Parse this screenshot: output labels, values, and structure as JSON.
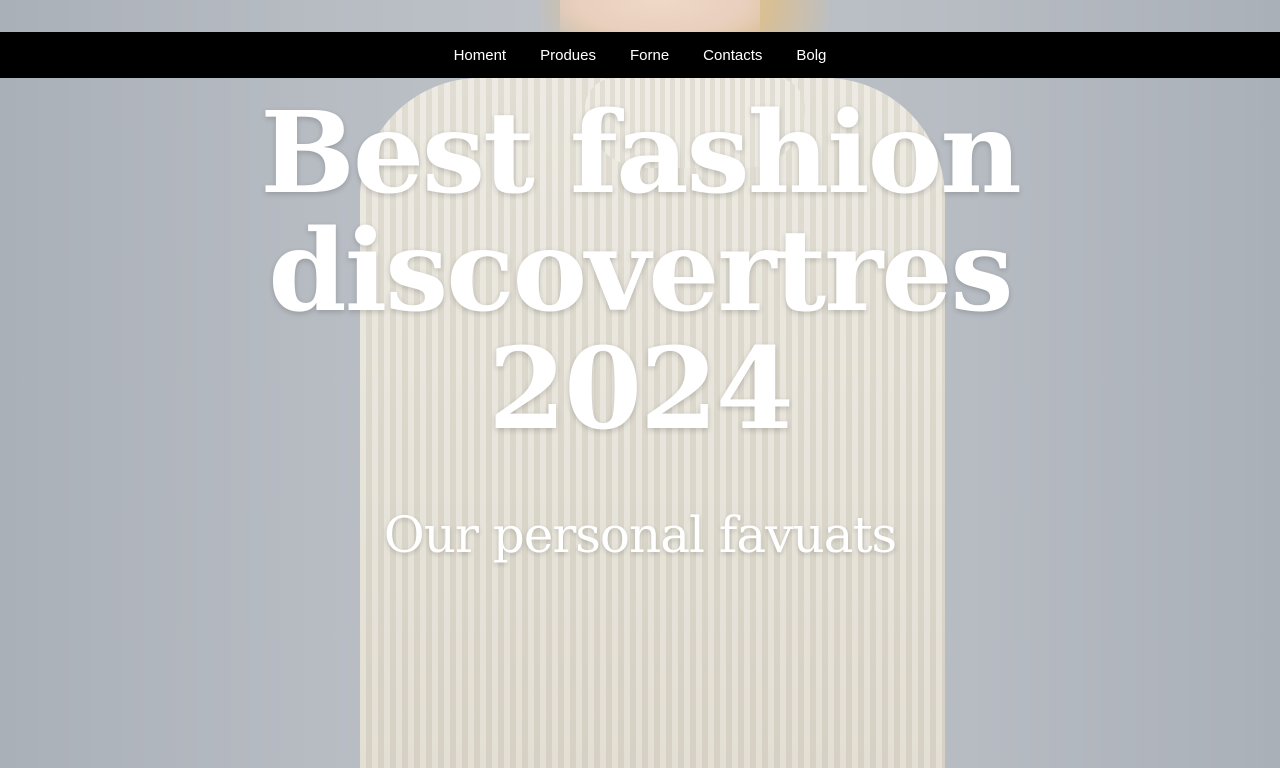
{
  "nav": {
    "items": [
      {
        "label": "Homent"
      },
      {
        "label": "Produes"
      },
      {
        "label": "Forne"
      },
      {
        "label": "Contacts"
      },
      {
        "label": "Bolg"
      }
    ]
  },
  "hero": {
    "title_lines": [
      "Best fashion",
      "discovertres",
      "2024"
    ],
    "subtitle": "Our personal favuats"
  },
  "colors": {
    "nav_background": "#000000",
    "text": "#ffffff",
    "background": "#b7bcc3",
    "sweater": "#e5e1d7"
  }
}
